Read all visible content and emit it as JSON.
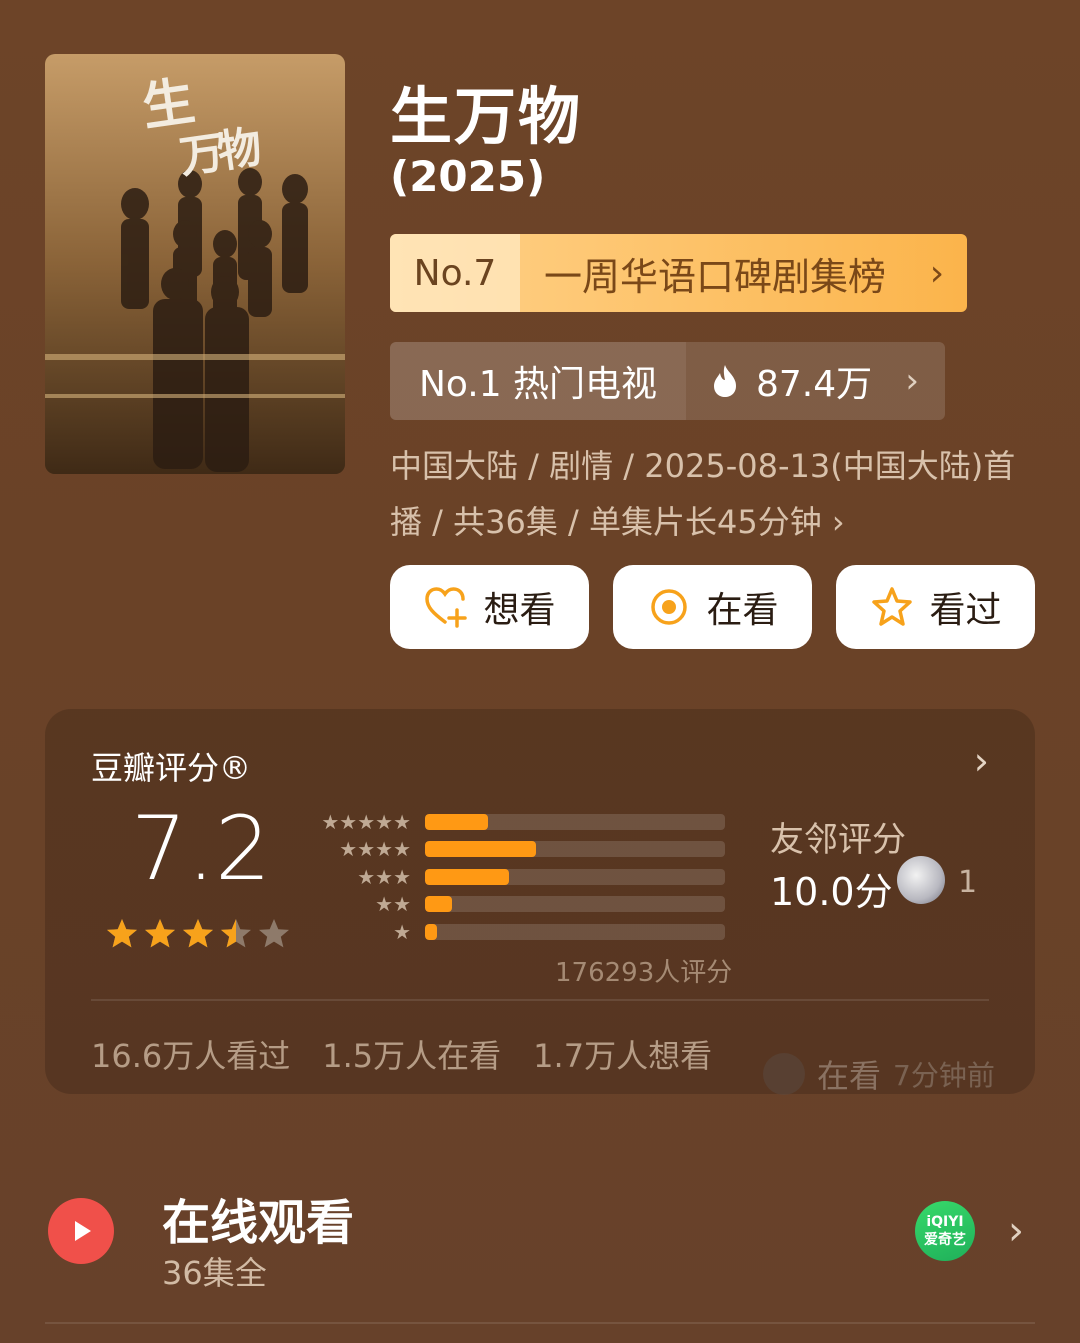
{
  "poster": {
    "logo_line1": "生",
    "logo_line2": "万物"
  },
  "movie": {
    "title": "生万物",
    "year": "(2025)"
  },
  "rank_weekly": {
    "number": "No.7",
    "label": "一周华语口碑剧集榜",
    "chevron": "›"
  },
  "rank_hot": {
    "label": "No.1 热门电视",
    "heat": "87.4万",
    "chevron": "›"
  },
  "meta": {
    "text": "中国大陆 / 剧情 / 2025-08-13(中国大陆)首播 / 共36集 / 单集片长45分钟 ›"
  },
  "actions": {
    "want": "想看",
    "watching": "在看",
    "watched": "看过"
  },
  "rating": {
    "title": "豆瓣评分®",
    "score": "7.2",
    "stars_value": 3.5,
    "stars_max": 5,
    "distribution": [
      {
        "stars": "★★★★★",
        "fraction": 0.21
      },
      {
        "stars": "★★★★",
        "fraction": 0.37
      },
      {
        "stars": "★★★",
        "fraction": 0.28
      },
      {
        "stars": "★★",
        "fraction": 0.09
      },
      {
        "stars": "★",
        "fraction": 0.04
      }
    ],
    "count": "176293人评分",
    "friends_label": "友邻评分",
    "friends_score": "10.0分",
    "friends_count": "1",
    "stats": [
      "16.6万人看过",
      "1.5万人在看",
      "1.7万人想看"
    ],
    "recent_status": "在看",
    "recent_time": "7分钟前"
  },
  "watch": {
    "title": "在线观看",
    "subtitle": "36集全",
    "provider_line1": "iQIYI",
    "provider_line2": "爱奇艺",
    "chevron": "›"
  },
  "colors": {
    "background": "#6b4327",
    "accent_orange": "#ff9914",
    "star_gold": "#f7a21b",
    "play_red": "#f0504a",
    "iqiyi_green": "#2bc45f"
  }
}
